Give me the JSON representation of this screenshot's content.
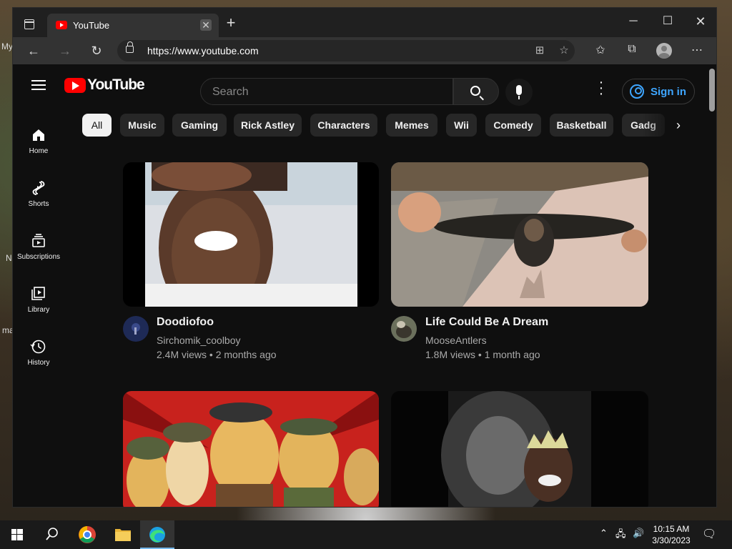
{
  "browser": {
    "tab_title": "YouTube",
    "url": "https://www.youtube.com"
  },
  "youtube": {
    "logo_text": "YouTube",
    "search_placeholder": "Search",
    "signin_label": "Sign in",
    "sidebar": [
      {
        "label": "Home",
        "icon": "home-icon"
      },
      {
        "label": "Shorts",
        "icon": "shorts-icon"
      },
      {
        "label": "Subscriptions",
        "icon": "subscriptions-icon"
      },
      {
        "label": "Library",
        "icon": "library-icon"
      },
      {
        "label": "History",
        "icon": "history-icon"
      }
    ],
    "chips": [
      "All",
      "Music",
      "Gaming",
      "Rick Astley",
      "Characters",
      "Memes",
      "Wii",
      "Comedy",
      "Basketball",
      "Gadg"
    ],
    "videos": [
      {
        "title": "Doodiofoo",
        "channel": "Sirchomik_coolboy",
        "meta": "2.4M views • 2 months ago"
      },
      {
        "title": "Life Could Be A Dream",
        "channel": "MooseAntlers",
        "meta": "1.8M views • 1 month ago"
      }
    ]
  },
  "desktop": {
    "fragments": [
      "My",
      "N",
      "ma"
    ]
  },
  "taskbar": {
    "time": "10:15 AM",
    "date": "3/30/2023"
  },
  "colors": {
    "youtube_red": "#ff0000",
    "link_blue": "#3ea6ff",
    "page_bg": "#0f0f0f",
    "chip_bg": "#272727"
  }
}
